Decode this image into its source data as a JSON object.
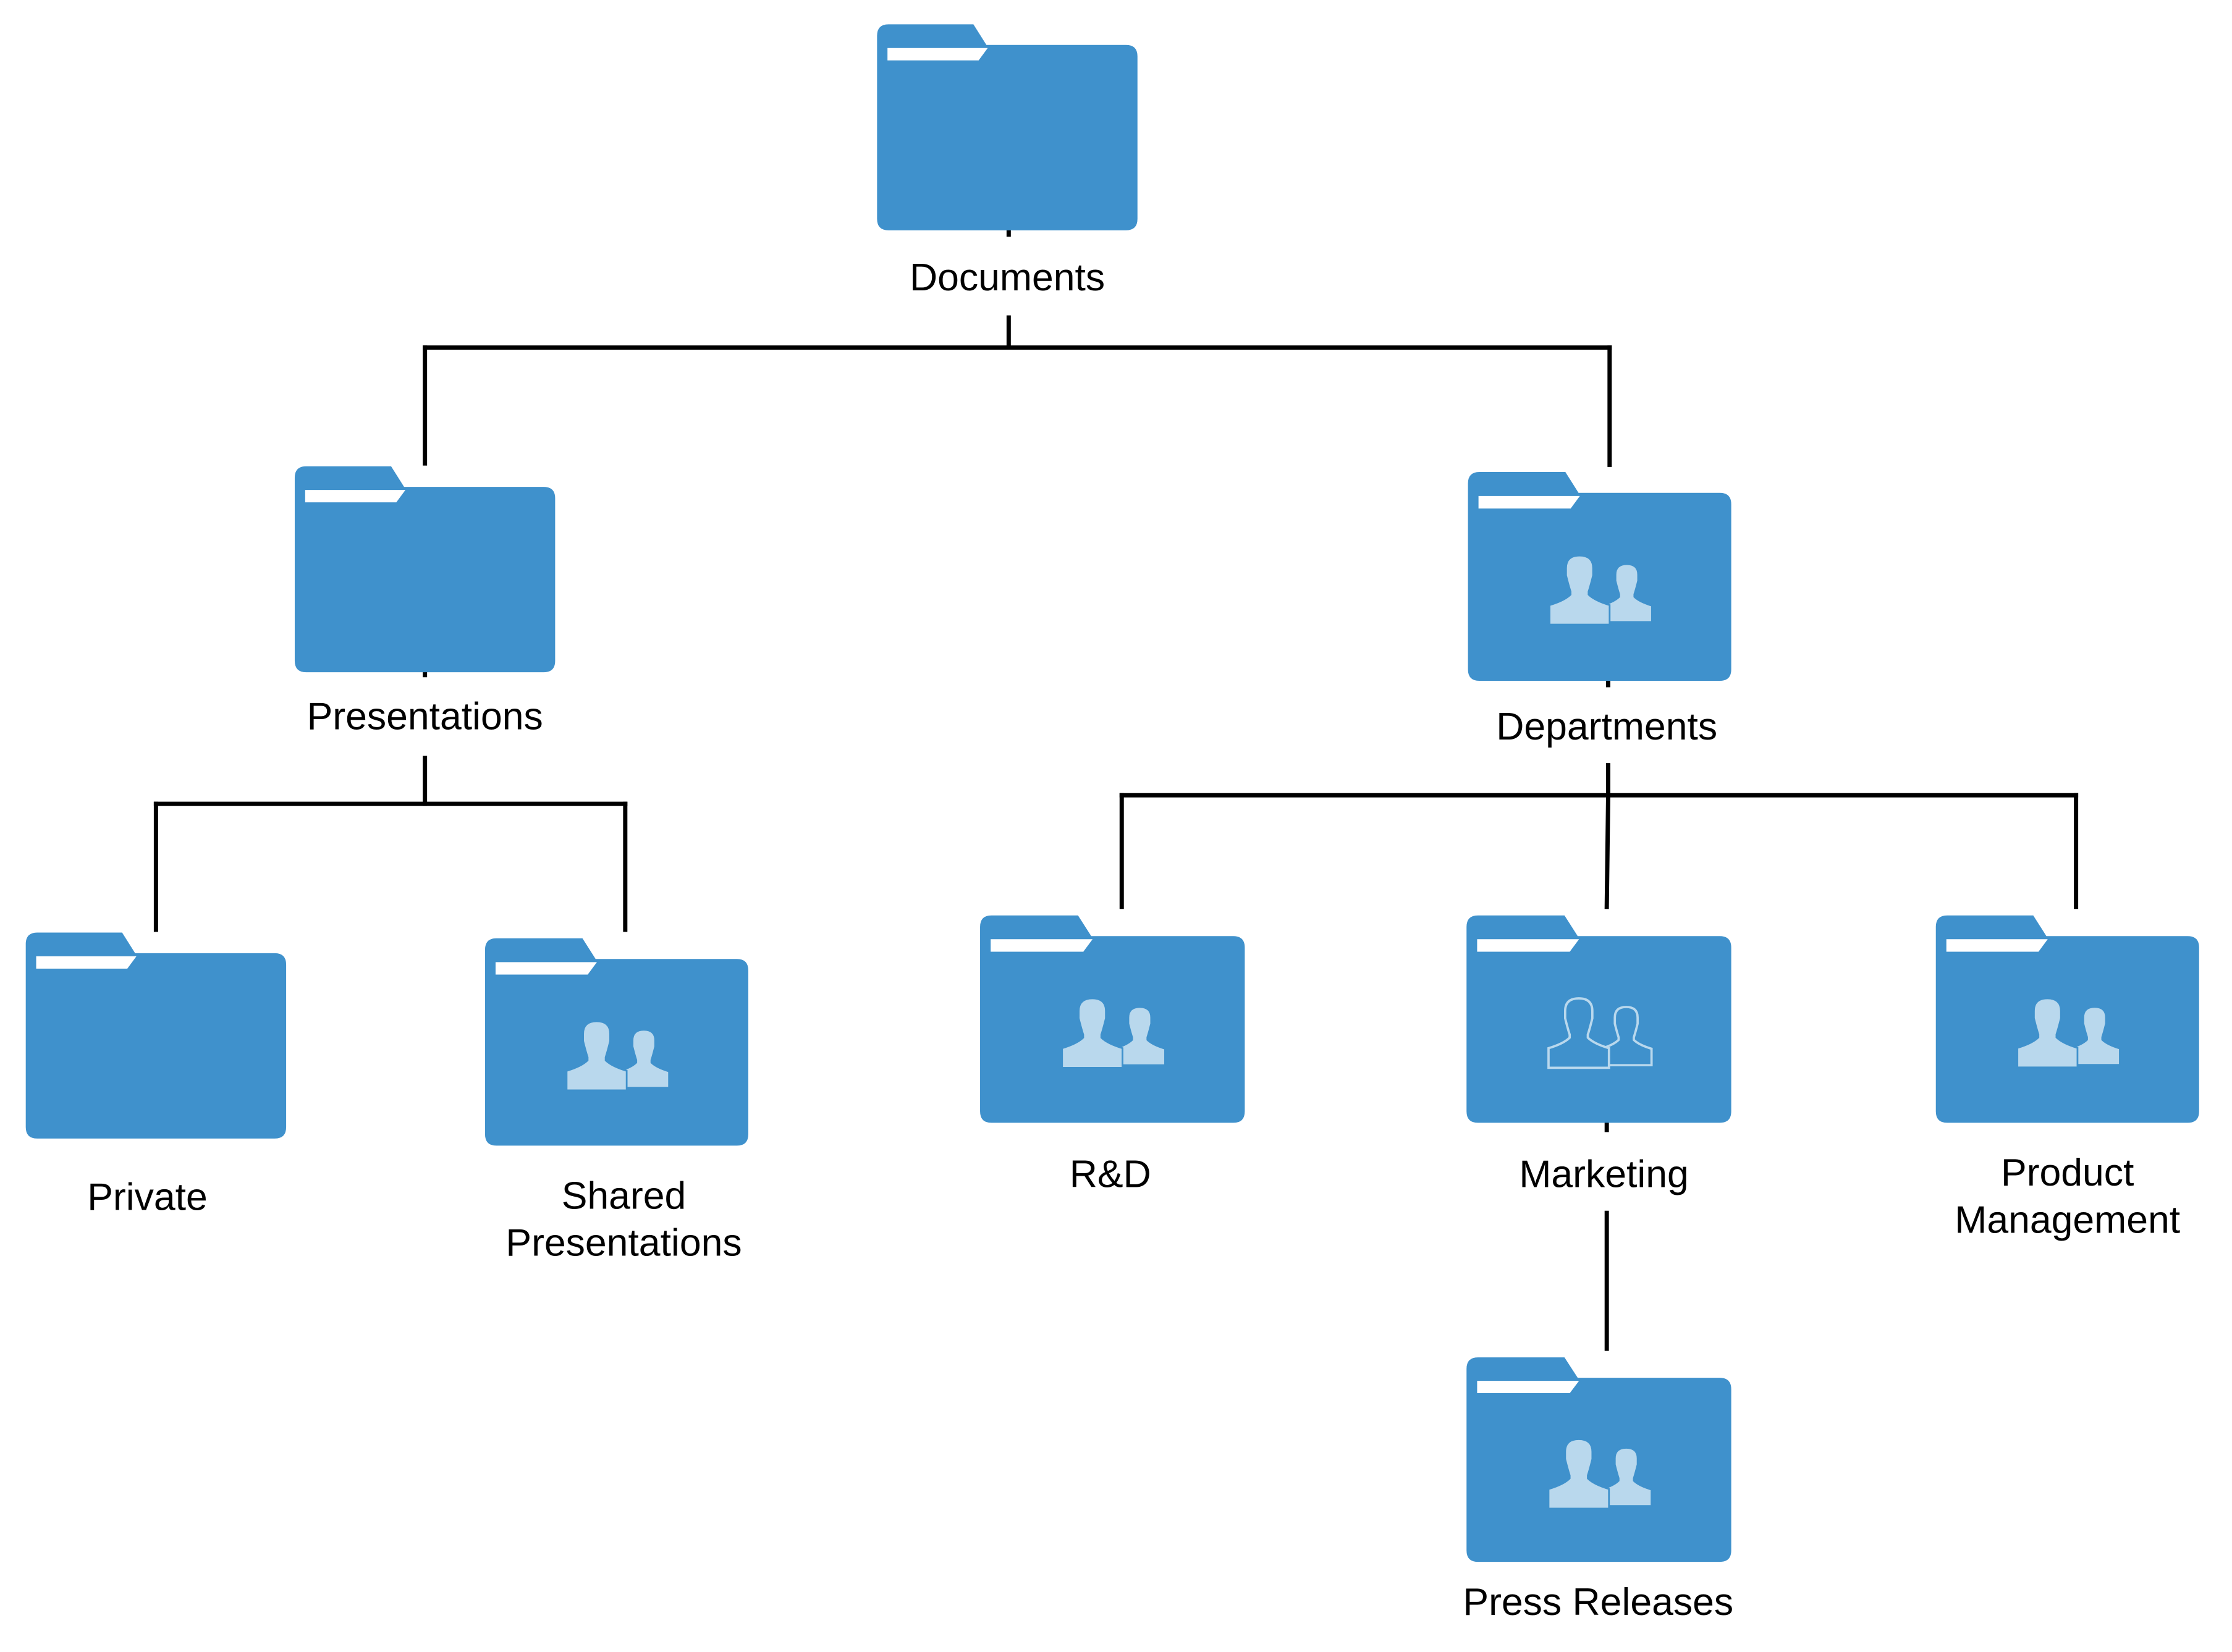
{
  "diagram": {
    "type": "folder-tree",
    "colors": {
      "folder": "#3f91cc",
      "folder_tab_slot": "#ffffff",
      "people_icon": "#b9d8ed",
      "connector": "#000000",
      "label": "#000000"
    },
    "nodes": [
      {
        "id": "documents",
        "label_lines": [
          "Documents"
        ],
        "icon": "folder-icon",
        "parent": null
      },
      {
        "id": "presentations",
        "label_lines": [
          "Presentations"
        ],
        "icon": "folder-icon",
        "parent": "documents"
      },
      {
        "id": "departments",
        "label_lines": [
          "Departments"
        ],
        "icon": "shared-folder-icon",
        "parent": "documents"
      },
      {
        "id": "private",
        "label_lines": [
          "Private"
        ],
        "icon": "folder-icon",
        "parent": "presentations"
      },
      {
        "id": "shared-presentations",
        "label_lines": [
          "Shared",
          "Presentations"
        ],
        "icon": "shared-folder-icon",
        "parent": "presentations"
      },
      {
        "id": "rnd",
        "label_lines": [
          "R&D"
        ],
        "icon": "shared-folder-icon",
        "parent": "departments"
      },
      {
        "id": "marketing",
        "label_lines": [
          "Marketing"
        ],
        "icon": "shared-folder-outline-icon",
        "parent": "departments"
      },
      {
        "id": "product-management",
        "label_lines": [
          "Product",
          "Management"
        ],
        "icon": "shared-folder-icon",
        "parent": "departments"
      },
      {
        "id": "press-releases",
        "label_lines": [
          "Press Releases"
        ],
        "icon": "shared-folder-icon",
        "parent": "marketing"
      }
    ]
  }
}
